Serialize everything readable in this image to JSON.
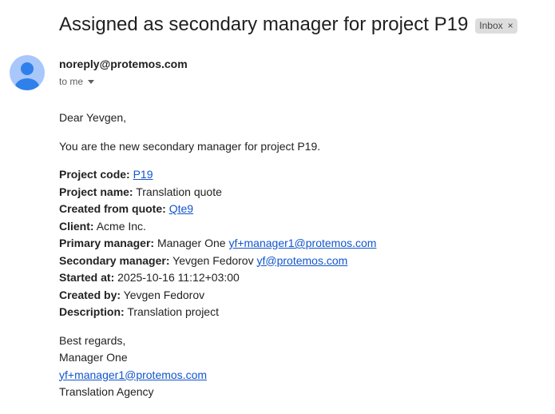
{
  "subject": "Assigned as secondary manager for project P19",
  "label": {
    "name": "Inbox",
    "close_glyph": "×"
  },
  "sender": {
    "email": "noreply@protemos.com",
    "avatar_icon": "person-icon",
    "avatar_color": "#a8c7fa"
  },
  "recipient": {
    "text": "to me",
    "caret_icon": "caret-down-icon"
  },
  "body": {
    "greeting": "Dear Yevgen,",
    "intro": "You are the new secondary manager for project P19.",
    "details": {
      "project_code": {
        "label": "Project code:",
        "value": "P19"
      },
      "project_name": {
        "label": "Project name:",
        "value": "Translation quote"
      },
      "created_from": {
        "label": "Created from quote:",
        "value": "Qte9"
      },
      "client": {
        "label": "Client:",
        "value": "Acme Inc."
      },
      "primary_manager": {
        "label": "Primary manager:",
        "name": "Manager One",
        "email": "yf+manager1@protemos.com"
      },
      "secondary_manager": {
        "label": "Secondary manager:",
        "name": "Yevgen Fedorov",
        "email": "yf@protemos.com"
      },
      "started_at": {
        "label": "Started at:",
        "value": "2025-10-16 11:12+03:00"
      },
      "created_by": {
        "label": "Created by:",
        "value": "Yevgen Fedorov"
      },
      "description": {
        "label": "Description:",
        "value": "Translation project"
      }
    },
    "signoff": {
      "regards": "Best regards,",
      "name": "Manager One",
      "email": "yf+manager1@protemos.com",
      "company": "Translation Agency"
    }
  },
  "colors": {
    "link": "#1155cc",
    "chip_bg": "#dddddd"
  }
}
